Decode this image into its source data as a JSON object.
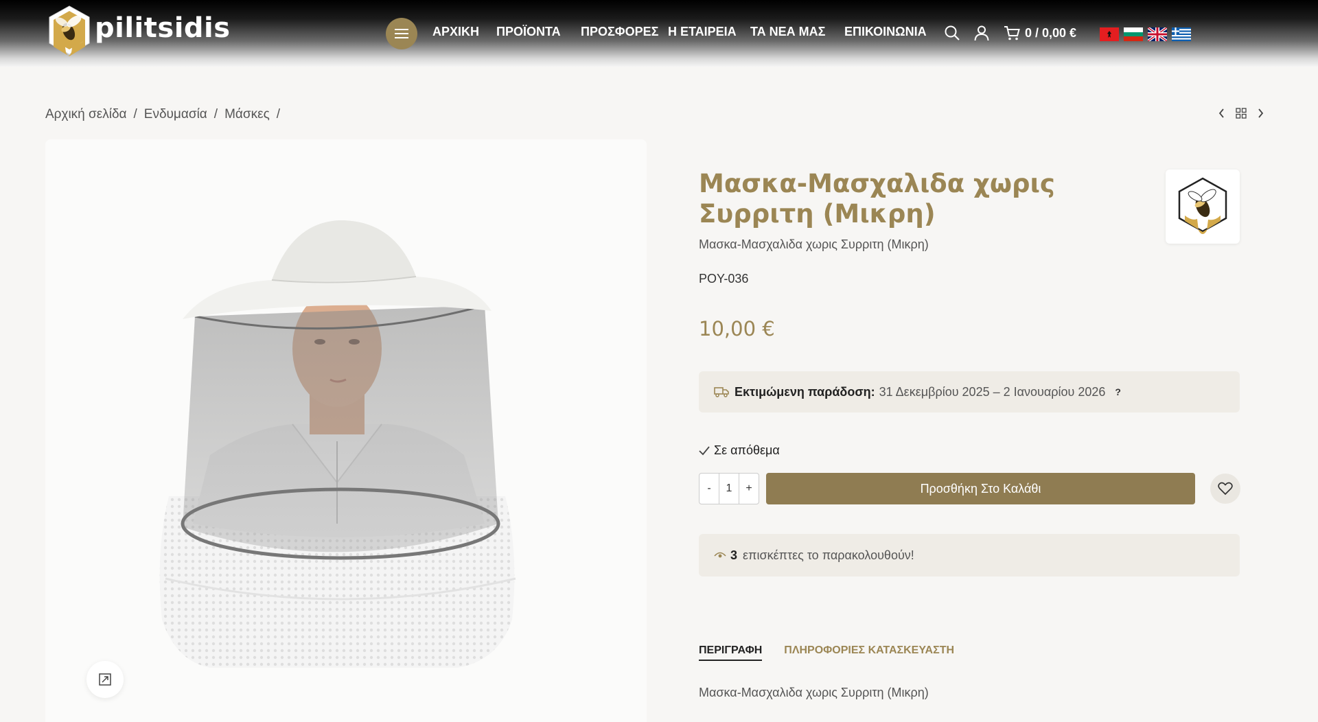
{
  "header": {
    "logo_text": "pilitsidis",
    "nav": [
      "ΑΡΧΙΚΗ",
      "ΠΡΟΪΟΝΤΑ",
      "ΠΡΟΣΦΟΡΕΣ",
      "Η ΕΤΑΙΡΕΙΑ",
      "ΤΑ ΝΕΑ ΜΑΣ",
      "ΕΠΙΚΟΙΝΩΝΙΑ"
    ],
    "cart": "0 / 0,00 €",
    "flags": [
      "albania-flag-icon",
      "bulgaria-flag-icon",
      "uk-flag-icon",
      "greece-flag-icon"
    ]
  },
  "breadcrumb": [
    "Αρχική σελίδα",
    "Ενδυμασία",
    "Μάσκες"
  ],
  "product": {
    "title": "Μασκα-Μασχαλιδα χωρις Συρριτη (Μικρη)",
    "subtitle": "Μασκα-Μασχαλιδα χωρις Συρριτη (Μικρη)",
    "sku": "POY-036",
    "price": "10,00 €",
    "delivery_label": "Εκτιμώμενη παράδοση:",
    "delivery_dates": "31 Δεκεμβρίου 2025 – 2 Ιανουαρίου 2026",
    "delivery_help": "?",
    "stock": "Σε απόθεμα",
    "qty_minus": "-",
    "qty_value": "1",
    "qty_plus": "+",
    "add_to_cart": "Προσθήκη Στο Καλάθι",
    "visitors_count": "3",
    "visitors_text": "επισκέπτες το παρακολουθούν!"
  },
  "tabs": [
    "ΠΕΡΙΓΡΑΦΗ",
    "ΠΛΗΡΟΦΟΡΙΕΣ ΚΑΤΑΣΚΕΥΑΣΤΗ"
  ],
  "description": "Μασκα-Μασχαλιδα χωρις Συρριτη (Μικρη)",
  "colors": {
    "accent": "#9b8654",
    "button": "#8f7c52",
    "panel": "#efece6"
  }
}
